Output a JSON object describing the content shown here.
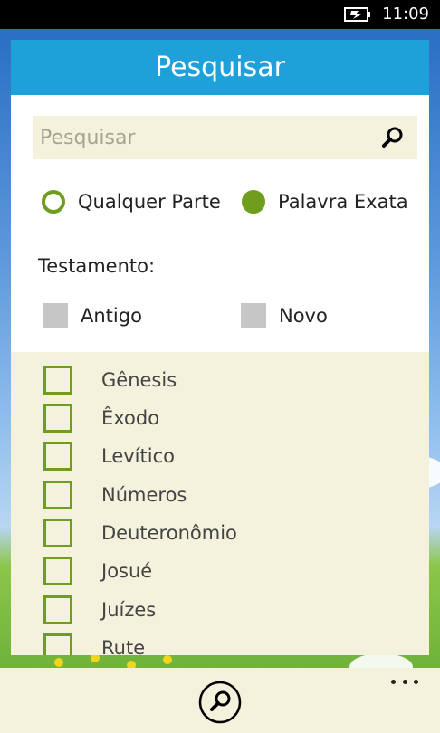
{
  "status_bar": {
    "time": "11:09",
    "icon": "battery-charging-icon"
  },
  "header": {
    "title": "Pesquisar"
  },
  "search": {
    "placeholder": "Pesquisar",
    "value": "",
    "icon": "search-icon"
  },
  "match_mode": {
    "options": [
      {
        "label": "Qualquer Parte",
        "selected": false
      },
      {
        "label": "Palavra Exata",
        "selected": true
      }
    ]
  },
  "testament": {
    "label": "Testamento:",
    "options": [
      {
        "label": "Antigo",
        "checked": false
      },
      {
        "label": "Novo",
        "checked": false
      }
    ]
  },
  "books": [
    "Gênesis",
    "Êxodo",
    "Levítico",
    "Números",
    "Deuteronômio",
    "Josué",
    "Juízes",
    "Rute"
  ],
  "app_bar": {
    "search_icon": "search-icon",
    "more_icon": "more-icon"
  },
  "colors": {
    "accent": "#6f9e1f",
    "header": "#1ea1d9",
    "panel_bg": "#f4f2dc"
  }
}
